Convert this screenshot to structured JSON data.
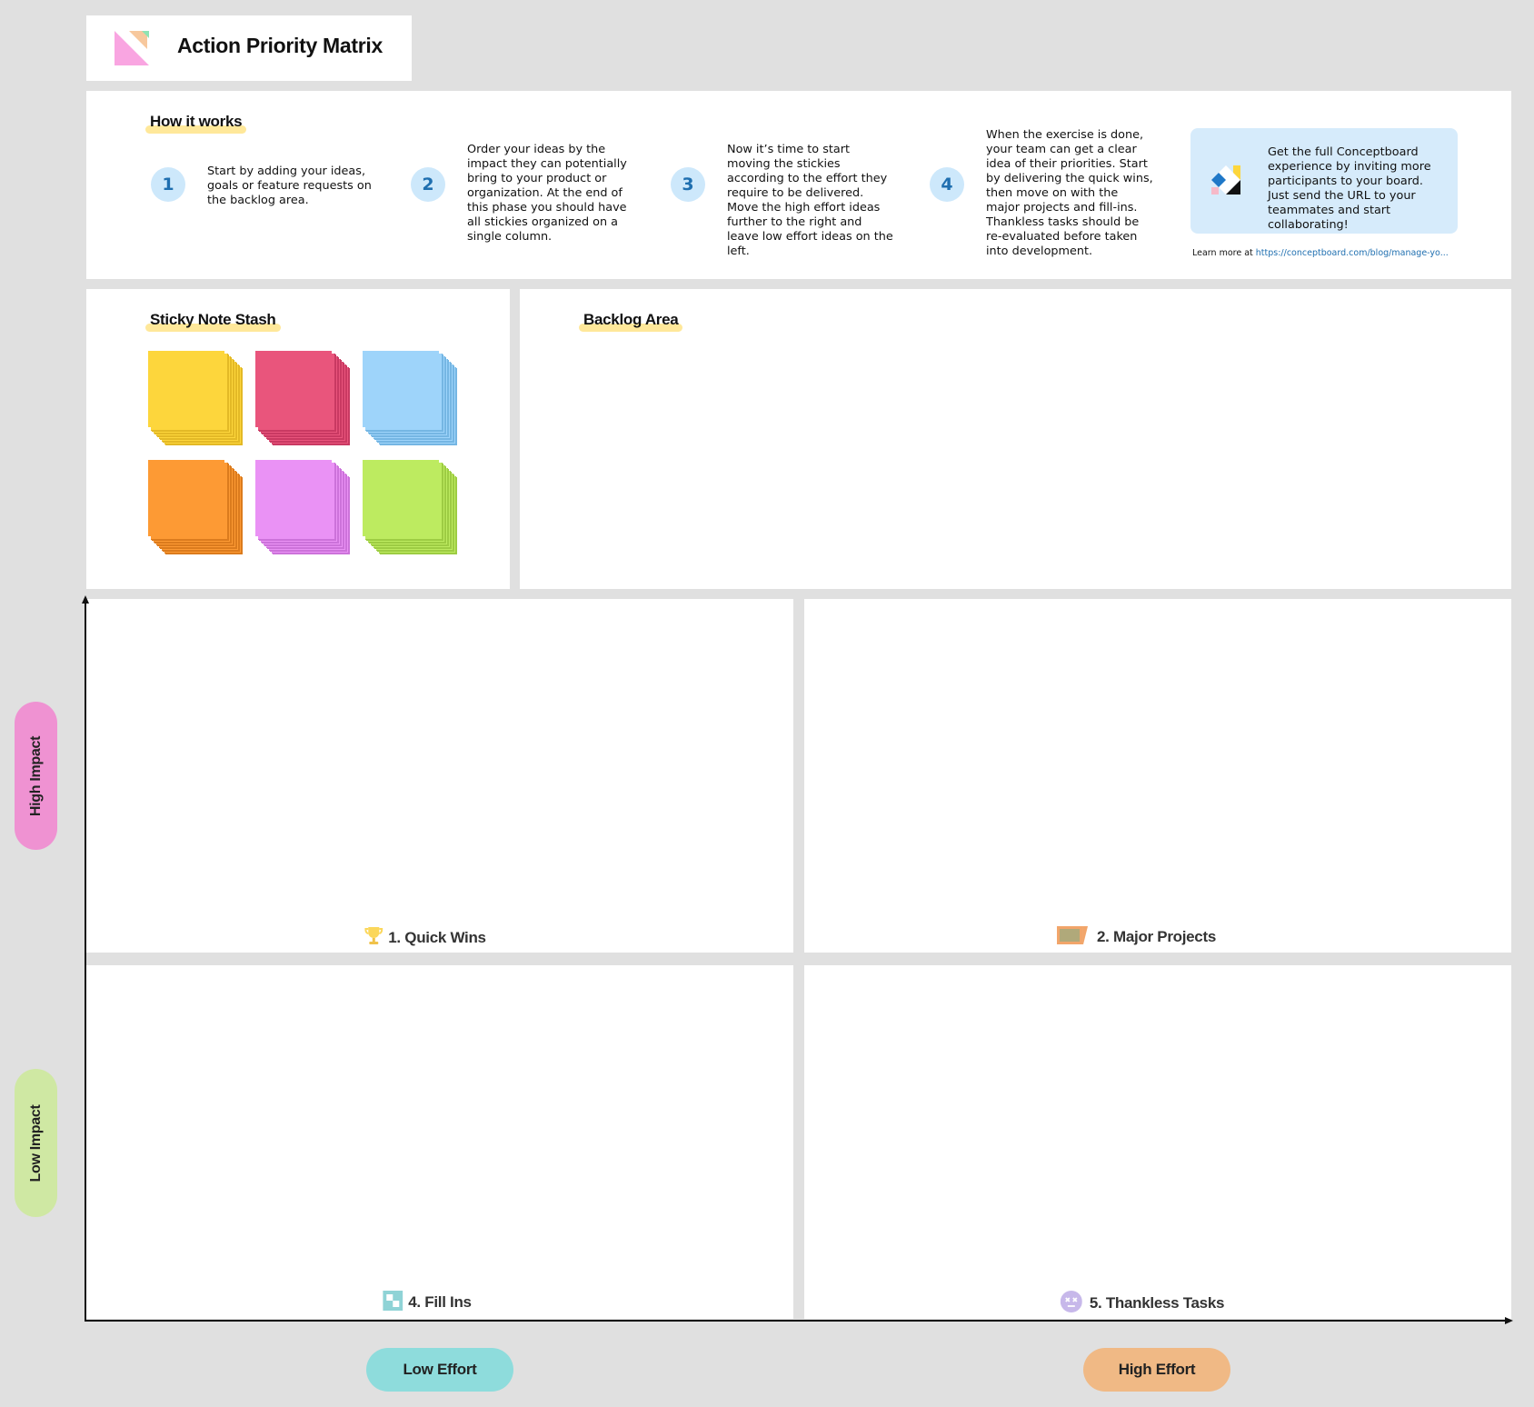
{
  "title": "Action Priority Matrix",
  "how_it_works": {
    "heading": "How it works",
    "steps": [
      {
        "number": "1",
        "text": "Start by adding your ideas, goals or feature requests on the backlog area."
      },
      {
        "number": "2",
        "text": "Order your ideas by the impact they can potentially bring to your product or organization. At the end of this phase you should have all stickies organized on a single column."
      },
      {
        "number": "3",
        "text": "Now it’s time to start moving the stickies according to the effort they require to be delivered. Move the high effort ideas further to the right and leave low effort ideas on the left."
      },
      {
        "number": "4",
        "text": "When the exercise is done, your team can get a clear idea of their priorities. Start by delivering the quick wins, then move on with the major projects and fill-ins. Thankless tasks should be re-evaluated before taken into development."
      }
    ],
    "promo_text": "Get the full Conceptboard experience by inviting more participants to your board. Just send the URL to your teammates and start collaborating!",
    "learn_more_prefix": "Learn more at",
    "learn_more_link": "https://conceptboard.com/blog/manage-yo..."
  },
  "sticky_stash": {
    "heading": "Sticky Note Stash",
    "colors": [
      {
        "name": "yellow",
        "fill": "#fdd63c",
        "edge": "#e3b926"
      },
      {
        "name": "red",
        "fill": "#e9557c",
        "edge": "#c93962"
      },
      {
        "name": "blue",
        "fill": "#9ed4fa",
        "edge": "#75b6e3"
      },
      {
        "name": "orange",
        "fill": "#fd9a34",
        "edge": "#db7b1d"
      },
      {
        "name": "violet",
        "fill": "#ea92f5",
        "edge": "#cc72da"
      },
      {
        "name": "green",
        "fill": "#bdeb60",
        "edge": "#9dcc43"
      }
    ]
  },
  "backlog": {
    "heading": "Backlog Area"
  },
  "quadrants": [
    {
      "label": "1. Quick Wins",
      "icon": "trophy-icon"
    },
    {
      "label": "2. Major Projects",
      "icon": "folder-icon"
    },
    {
      "label": "4. Fill Ins",
      "icon": "checker-icon"
    },
    {
      "label": "5. Thankless Tasks",
      "icon": "dizzy-face-icon"
    }
  ],
  "axes": {
    "high_impact": "High Impact",
    "low_impact": "Low Impact",
    "low_effort": "Low Effort",
    "high_effort": "High Effort"
  },
  "colors": {
    "background": "#e0e0e0",
    "high_impact": "#ef92d2",
    "low_impact": "#cfe8a3",
    "low_effort": "#8edcdc",
    "high_effort": "#f0b985",
    "promo_box": "#d6ebfb",
    "link": "#1f6fb0"
  }
}
